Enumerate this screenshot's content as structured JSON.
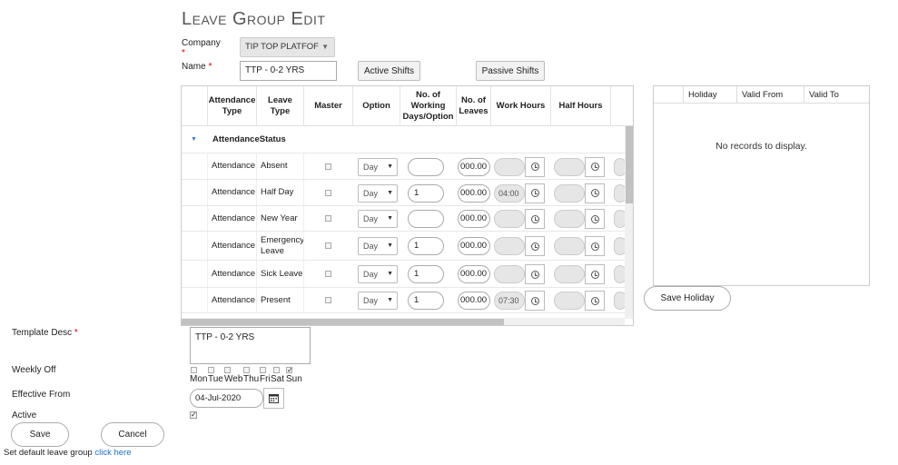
{
  "page": {
    "title": "Leave Group Edit"
  },
  "form": {
    "company_label": "Company",
    "company_value": "TIP TOP PLATFOF",
    "name_label": "Name",
    "name_value": "TTP - 0-2 YRS",
    "active_shifts_label": "Active Shifts",
    "passive_shifts_label": "Passive Shifts",
    "template_desc_label": "Template Desc",
    "template_desc_value": "TTP - 0-2 YRS",
    "weekly_off_label": "Weekly Off",
    "weekdays": [
      "Mon",
      "Tue",
      "Web",
      "Thu",
      "Fri",
      "Sat",
      "Sun"
    ],
    "weekly_off_checked": [
      false,
      false,
      false,
      false,
      false,
      false,
      true
    ],
    "effective_from_label": "Effective From",
    "effective_from_value": "04-Jul-2020",
    "active_label": "Active",
    "active_checked": true,
    "save_label": "Save",
    "cancel_label": "Cancel",
    "default_text": "Set default leave group",
    "default_link": "click here",
    "required_mark": "*"
  },
  "grid": {
    "columns": [
      "Attendance Type",
      "Leave Type",
      "Master",
      "Option",
      "No. of Working Days/Option",
      "No. of Leaves",
      "Work Hours",
      "Half Hours"
    ],
    "group_label": "Attendance Status",
    "group_label_a": "Attendance",
    "group_label_b": "Status",
    "rows": [
      {
        "type": "Attendance",
        "leave": "Absent",
        "option": "Day",
        "days": "",
        "leaves": "000.00",
        "work": "",
        "half": ""
      },
      {
        "type": "Attendance",
        "leave": "Half Day",
        "option": "Day",
        "days": "1",
        "leaves": "000.00",
        "work": "04:00",
        "half": ""
      },
      {
        "type": "Attendance",
        "leave": "New Year",
        "option": "Day",
        "days": "",
        "leaves": "000.00",
        "work": "",
        "half": ""
      },
      {
        "type": "Attendance",
        "leave": "Emergency Leave",
        "option": "Day",
        "days": "1",
        "leaves": "000.00",
        "work": "",
        "half": ""
      },
      {
        "type": "Attendance",
        "leave": "Sick Leave",
        "option": "Day",
        "days": "1",
        "leaves": "000.00",
        "work": "",
        "half": ""
      },
      {
        "type": "Attendance",
        "leave": "Present",
        "option": "Day",
        "days": "1",
        "leaves": "000.00",
        "work": "07:30",
        "half": ""
      }
    ]
  },
  "holiday": {
    "columns": [
      "Holiday",
      "Valid From",
      "Valid To"
    ],
    "empty_text": "No records to display.",
    "save_label": "Save Holiday"
  },
  "icons": {
    "calendar": "calendar-icon",
    "clock": "clock-icon",
    "expand": "caret-down-icon"
  },
  "colors": {
    "link": "#1a6fc4",
    "required": "#dd0000",
    "title": "#555555"
  }
}
